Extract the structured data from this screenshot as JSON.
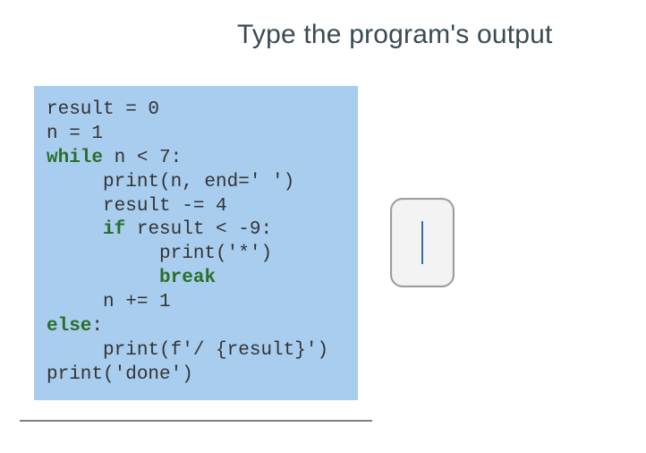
{
  "title": "Type the program's output",
  "code": {
    "l1a": "result = ",
    "l1b": "0",
    "l2a": "n = ",
    "l2b": "1",
    "l3a": "while",
    "l3b": " n < ",
    "l3c": "7",
    "l3d": ":",
    "l4a": "     print(n, end=",
    "l4b": "' '",
    "l4c": ")",
    "l5a": "     result -= ",
    "l5b": "4",
    "l6a": "     ",
    "l6b": "if",
    "l6c": " result < ",
    "l6d": "-9",
    "l6e": ":",
    "l7a": "          print(",
    "l7b": "'*'",
    "l7c": ")",
    "l8a": "          ",
    "l8b": "break",
    "l9a": "     n += ",
    "l9b": "1",
    "l10a": "else",
    "l10b": ":",
    "l11a": "     print(f",
    "l11b": "'/ {result}'",
    "l11c": ")",
    "l12a": "print(",
    "l12b": "'done'",
    "l12c": ")"
  },
  "output": {
    "value": ""
  }
}
